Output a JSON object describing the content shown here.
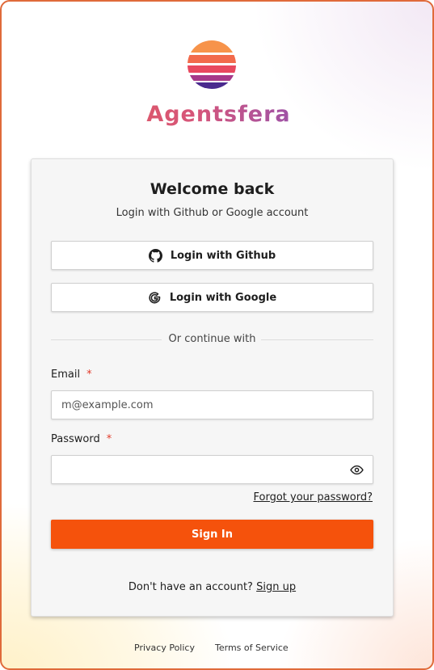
{
  "brand": {
    "name": "Agentsfera"
  },
  "card": {
    "title": "Welcome back",
    "subtitle": "Login with Github or Google account",
    "github_label": "Login with Github",
    "google_label": "Login with Google",
    "divider_text": "Or continue with",
    "email": {
      "label": "Email",
      "required_mark": "*",
      "placeholder": "m@example.com",
      "value": ""
    },
    "password": {
      "label": "Password",
      "required_mark": "*",
      "value": ""
    },
    "forgot_label": "Forgot your password?",
    "signin_label": "Sign In",
    "signup_prompt": "Don't have an account?",
    "signup_label": "Sign up"
  },
  "footer": {
    "privacy_label": "Privacy Policy",
    "terms_label": "Terms of Service"
  },
  "colors": {
    "accent": "#f5520c",
    "frame_border": "#e06a3a",
    "card_bg": "#f6f6f6"
  },
  "icons": {
    "logo": "agentsfera-sun-logo",
    "github": "github-icon",
    "google": "google-icon",
    "show_password": "eye-icon"
  }
}
